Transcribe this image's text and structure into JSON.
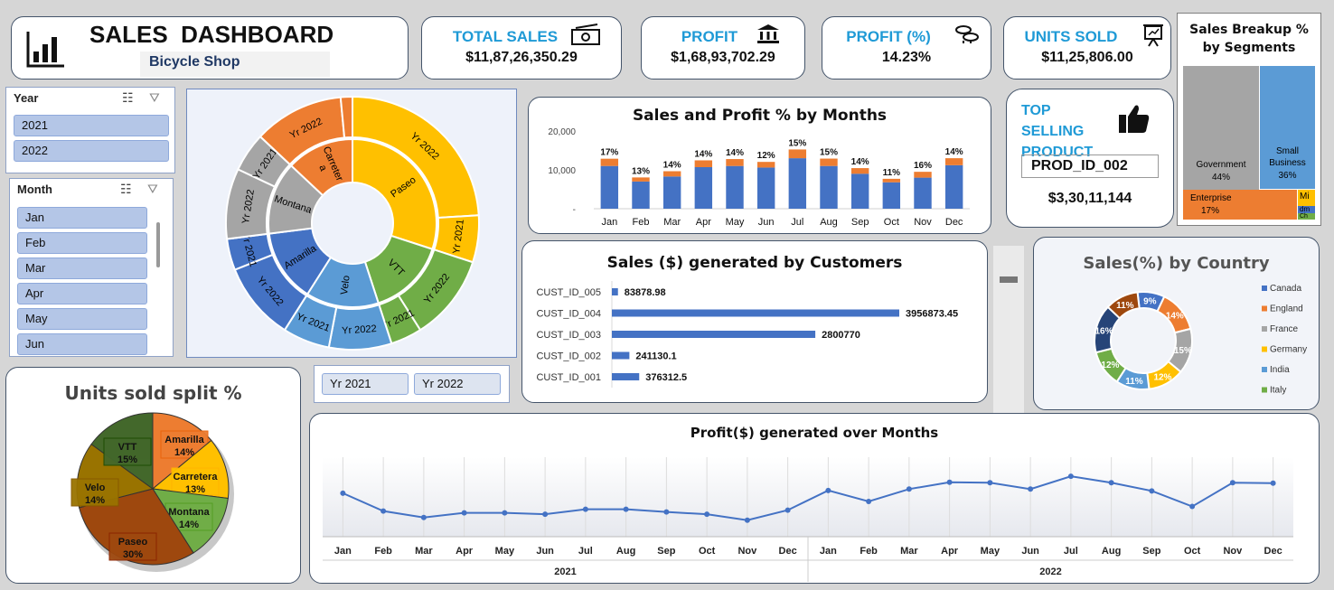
{
  "header": {
    "title": "SALES  DASHBOARD",
    "subtitle": "Bicycle Shop"
  },
  "kpis": {
    "total_sales": {
      "label": "TOTAL SALES",
      "value": "$11,87,26,350.29",
      "icon": "money-icon"
    },
    "profit": {
      "label": "PROFIT",
      "value": "$1,68,93,702.29",
      "icon": "bank-icon"
    },
    "profit_pct": {
      "label": "PROFIT (%)",
      "value": "14.23%",
      "icon": "coins-icon"
    },
    "units_sold": {
      "label": "UNITS SOLD",
      "value": "$11,25,806.00",
      "icon": "presentation-icon"
    }
  },
  "top_product": {
    "label": "TOP SELLING PRODUCT",
    "id": "PROD_ID_002",
    "value": "$3,30,11,144",
    "icon": "thumbs-up-icon"
  },
  "slicers": {
    "year": {
      "label": "Year",
      "items": [
        "2021",
        "2022"
      ]
    },
    "month": {
      "label": "Month",
      "items": [
        "Jan",
        "Feb",
        "Mar",
        "Apr",
        "May",
        "Jun"
      ]
    },
    "timeline": {
      "items": [
        "Yr 2021",
        "Yr 2022"
      ]
    }
  },
  "colors": {
    "accent": "#1f9ad6",
    "blue": "#4472c4",
    "orange": "#ed7d31",
    "gray": "#a5a5a5",
    "gold": "#ffc000",
    "lightblue": "#5b9bd5",
    "green": "#70ad47"
  },
  "chart_data": [
    {
      "id": "sunburst",
      "type": "sunburst",
      "inner": [
        {
          "name": "Paseo",
          "value": 30,
          "color": "#ffc000"
        },
        {
          "name": "VTT",
          "value": 15,
          "color": "#70ad47"
        },
        {
          "name": "Velo",
          "value": 14,
          "color": "#5b9bd5"
        },
        {
          "name": "Amarilla",
          "value": 14,
          "color": "#4472c4"
        },
        {
          "name": "Montana",
          "value": 14,
          "color": "#a5a5a5"
        },
        {
          "name": "Carretera",
          "value": 13,
          "color": "#ed7d31"
        }
      ],
      "inner_labels": [
        "Paseo",
        "VTT",
        "Velo",
        "Amarilla",
        "Montana",
        "Carreter\na"
      ],
      "outer": [
        {
          "parent": 0,
          "name": "Yr 2022",
          "value": 24
        },
        {
          "parent": 0,
          "name": "Yr 2021",
          "value": 6
        },
        {
          "parent": 1,
          "name": "Yr 2022",
          "value": 11
        },
        {
          "parent": 1,
          "name": "Yr 2021",
          "value": 4
        },
        {
          "parent": 2,
          "name": "Yr 2022",
          "value": 8
        },
        {
          "parent": 2,
          "name": "Yr 2021",
          "value": 6
        },
        {
          "parent": 3,
          "name": "Yr 2022",
          "value": 10
        },
        {
          "parent": 3,
          "name": "Yr 2021",
          "value": 4
        },
        {
          "parent": 4,
          "name": "Yr 2022",
          "value": 9
        },
        {
          "parent": 4,
          "name": "Yr 2021",
          "value": 5
        },
        {
          "parent": 5,
          "name": "Yr 2022",
          "value": 11.5
        },
        {
          "parent": 5,
          "name": "",
          "value": 1.5
        }
      ]
    },
    {
      "id": "sales_profit_months",
      "type": "bar",
      "title": "Sales and Profit % by Months",
      "categories": [
        "Jan",
        "Feb",
        "Mar",
        "Apr",
        "May",
        "Jun",
        "Jul",
        "Aug",
        "Sep",
        "Oct",
        "Nov",
        "Dec"
      ],
      "series": [
        {
          "name": "Sales",
          "values": [
            11000,
            7000,
            8300,
            10700,
            11000,
            10600,
            13000,
            11000,
            9000,
            6800,
            8000,
            11200
          ]
        },
        {
          "name": "Profit",
          "values": [
            1870,
            1050,
            1350,
            1750,
            1780,
            1450,
            2250,
            1900,
            1450,
            900,
            1500,
            1800
          ]
        }
      ],
      "data_labels": [
        "17%",
        "13%",
        "14%",
        "14%",
        "14%",
        "12%",
        "15%",
        "15%",
        "14%",
        "11%",
        "16%",
        "14%"
      ],
      "y_ticks": [
        "20,000",
        "10,000",
        "-"
      ],
      "ylim": [
        0,
        20000
      ]
    },
    {
      "id": "customers",
      "type": "bar",
      "title": "Sales ($) generated by Customers",
      "categories": [
        "CUST_ID_005",
        "CUST_ID_004",
        "CUST_ID_003",
        "CUST_ID_002",
        "CUST_ID_001"
      ],
      "values": [
        83878.98,
        3956873.45,
        2800770,
        241130.1,
        376312.5
      ],
      "value_labels": [
        "83878.98",
        "3956873.45",
        "2800770",
        "241130.1",
        "376312.5"
      ]
    },
    {
      "id": "segments",
      "type": "treemap",
      "title": "Sales Breakup % by Segments",
      "items": [
        {
          "name": "Government",
          "label": "44%",
          "color": "#a5a5a5"
        },
        {
          "name": "Small Business",
          "label": "36%",
          "color": "#5b9bd5"
        },
        {
          "name": "Enterprise",
          "label": "17%",
          "color": "#ed7d31"
        },
        {
          "name": "Mi",
          "label": "",
          "color": "#ffc000"
        },
        {
          "name": "dm",
          "label": "",
          "color": "#4472c4"
        },
        {
          "name": "Ch",
          "label": "",
          "color": "#70ad47"
        }
      ]
    },
    {
      "id": "country",
      "type": "pie",
      "title": "Sales(%) by Country",
      "slices": [
        {
          "name": "Canada",
          "value": 9,
          "label": "9%",
          "color": "#4472c4"
        },
        {
          "name": "England",
          "value": 14,
          "label": "14%",
          "color": "#ed7d31"
        },
        {
          "name": "France",
          "value": 15,
          "label": "15%",
          "color": "#a5a5a5"
        },
        {
          "name": "Germany",
          "value": 12,
          "label": "12%",
          "color": "#ffc000"
        },
        {
          "name": "India",
          "value": 11,
          "label": "11%",
          "color": "#5b9bd5"
        },
        {
          "name": "Italy",
          "value": 12,
          "label": "12%",
          "color": "#70ad47"
        },
        {
          "name": "",
          "value": 16,
          "label": "16%",
          "color": "#264478"
        },
        {
          "name": "",
          "value": 11,
          "label": "11%",
          "color": "#9e480e"
        }
      ],
      "legend": [
        "Canada",
        "England",
        "France",
        "Germany",
        "India",
        "Italy"
      ]
    },
    {
      "id": "units_split",
      "type": "pie",
      "title": "Units sold split %",
      "slices": [
        {
          "name": "Amarilla",
          "value": 14,
          "label": "14%",
          "color": "#ed7d31"
        },
        {
          "name": "Carretera",
          "value": 13,
          "label": "13%",
          "color": "#ffc000"
        },
        {
          "name": "Montana",
          "value": 14,
          "label": "14%",
          "color": "#70ad47"
        },
        {
          "name": "Paseo",
          "value": 30,
          "label": "30%",
          "color": "#9e480e"
        },
        {
          "name": "Velo",
          "value": 14,
          "label": "14%",
          "color": "#997300"
        },
        {
          "name": "VTT",
          "value": 15,
          "label": "15%",
          "color": "#43682b"
        }
      ]
    },
    {
      "id": "profit_months",
      "type": "line",
      "title": "Profit($) generated over Months",
      "categories": [
        "Jan",
        "Feb",
        "Mar",
        "Apr",
        "May",
        "Jun",
        "Jul",
        "Aug",
        "Sep",
        "Oct",
        "Nov",
        "Dec",
        "Jan",
        "Feb",
        "Mar",
        "Apr",
        "May",
        "Jun",
        "Jul",
        "Aug",
        "Sep",
        "Oct",
        "Nov",
        "Dec"
      ],
      "groups": [
        "2021",
        "2022"
      ],
      "values": [
        950,
        560,
        420,
        520,
        520,
        490,
        600,
        600,
        540,
        490,
        360,
        580,
        1010,
        770,
        1040,
        1190,
        1180,
        1040,
        1320,
        1180,
        1000,
        660,
        1180,
        1170
      ],
      "ylim": [
        0,
        1500
      ]
    }
  ]
}
